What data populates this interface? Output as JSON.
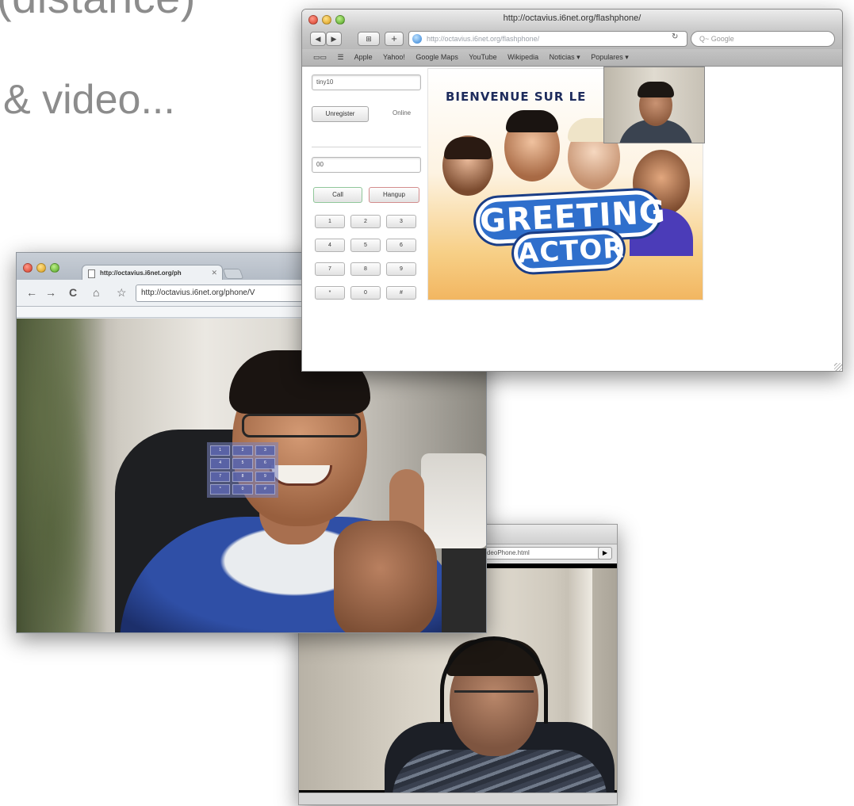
{
  "slide": {
    "line1": "(distance)",
    "line2": "& video..."
  },
  "safari": {
    "title": "http://octavius.i6net.org/flashphone/",
    "url": "http://octavius.i6net.org/flashphone/",
    "search_placeholder": "Q~ Google",
    "bookmarks": [
      "Apple",
      "Yahoo!",
      "Google Maps",
      "YouTube",
      "Wikipedia",
      "Noticias ▾",
      "Populares ▾"
    ],
    "phone": {
      "sip_value": "tiny10",
      "unregister_label": "Unregister",
      "status": "Online",
      "number_value": "00",
      "call_label": "Call",
      "hangup_label": "Hangup",
      "keys": [
        "1",
        "2",
        "3",
        "4",
        "5",
        "6",
        "7",
        "8",
        "9",
        "*",
        "0",
        "#"
      ]
    },
    "banner": {
      "title": "BIENVENUE SUR LE",
      "greeting": "GREETING",
      "actor": "ACTOR"
    }
  },
  "chrome": {
    "tab_title": "http://octavius.i6net.org/ph",
    "url": "http://octavius.i6net.org/phone/V",
    "dialpad_keys": [
      "1",
      "2",
      "3",
      "4",
      "5",
      "6",
      "7",
      "8",
      "9",
      "*",
      "0",
      "#"
    ]
  },
  "small_window": {
    "address": "VideoPhone.html",
    "go_label": "▶"
  }
}
